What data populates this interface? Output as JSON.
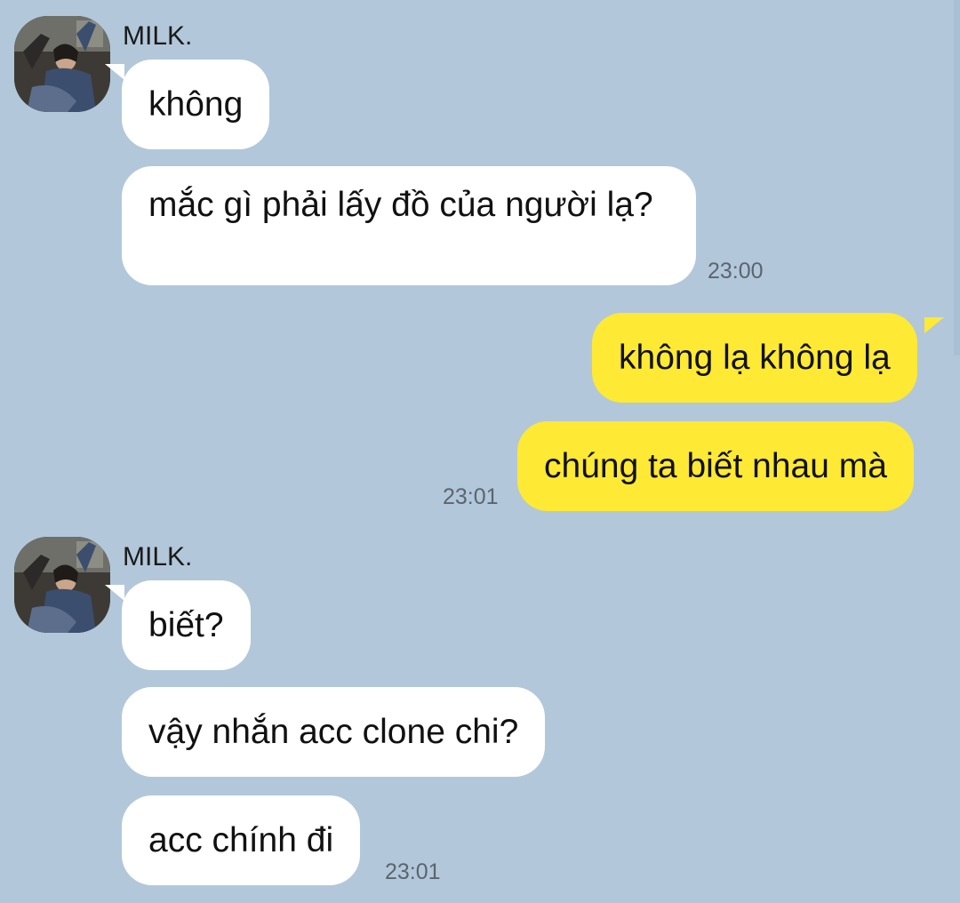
{
  "contact": {
    "name": "MILK."
  },
  "colors": {
    "background": "#b2c7da",
    "incoming_bubble": "#ffffff",
    "outgoing_bubble": "#fee934",
    "timestamp": "#5b6570"
  },
  "messages": [
    {
      "direction": "incoming",
      "text": "không"
    },
    {
      "direction": "incoming",
      "text": "mắc gì phải lấy đồ của người lạ?",
      "time": "23:00"
    },
    {
      "direction": "outgoing",
      "text": "không lạ không lạ"
    },
    {
      "direction": "outgoing",
      "text": "chúng ta biết nhau mà",
      "time": "23:01"
    },
    {
      "direction": "incoming",
      "text": "biết?"
    },
    {
      "direction": "incoming",
      "text": "vậy nhắn acc clone chi?"
    },
    {
      "direction": "incoming",
      "text": "acc chính đi",
      "time": "23:01"
    }
  ]
}
